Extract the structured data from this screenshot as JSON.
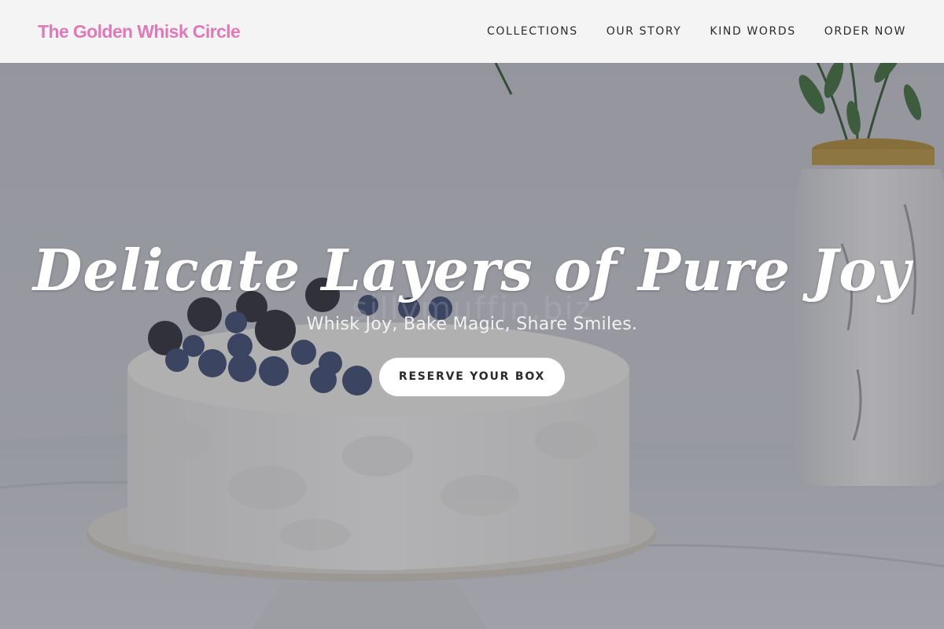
{
  "header": {
    "brand": "The Golden Whisk Circle",
    "nav": [
      "COLLECTIONS",
      "OUR STORY",
      "KIND WORDS",
      "ORDER NOW"
    ]
  },
  "hero": {
    "headline": "Delicate Layers of Pure Joy",
    "subhead": "Whisk Joy, Bake Magic, Share Smiles.",
    "cta": "RESERVE YOUR BOX",
    "watermark": "sillymuffin.biz",
    "image": "white frosted cake topped with blueberries and blackberries beside a marble vase"
  },
  "colors": {
    "brand_pink": "#e079b7",
    "header_bg": "#f4f4f4",
    "cta_bg": "#ffffff"
  }
}
